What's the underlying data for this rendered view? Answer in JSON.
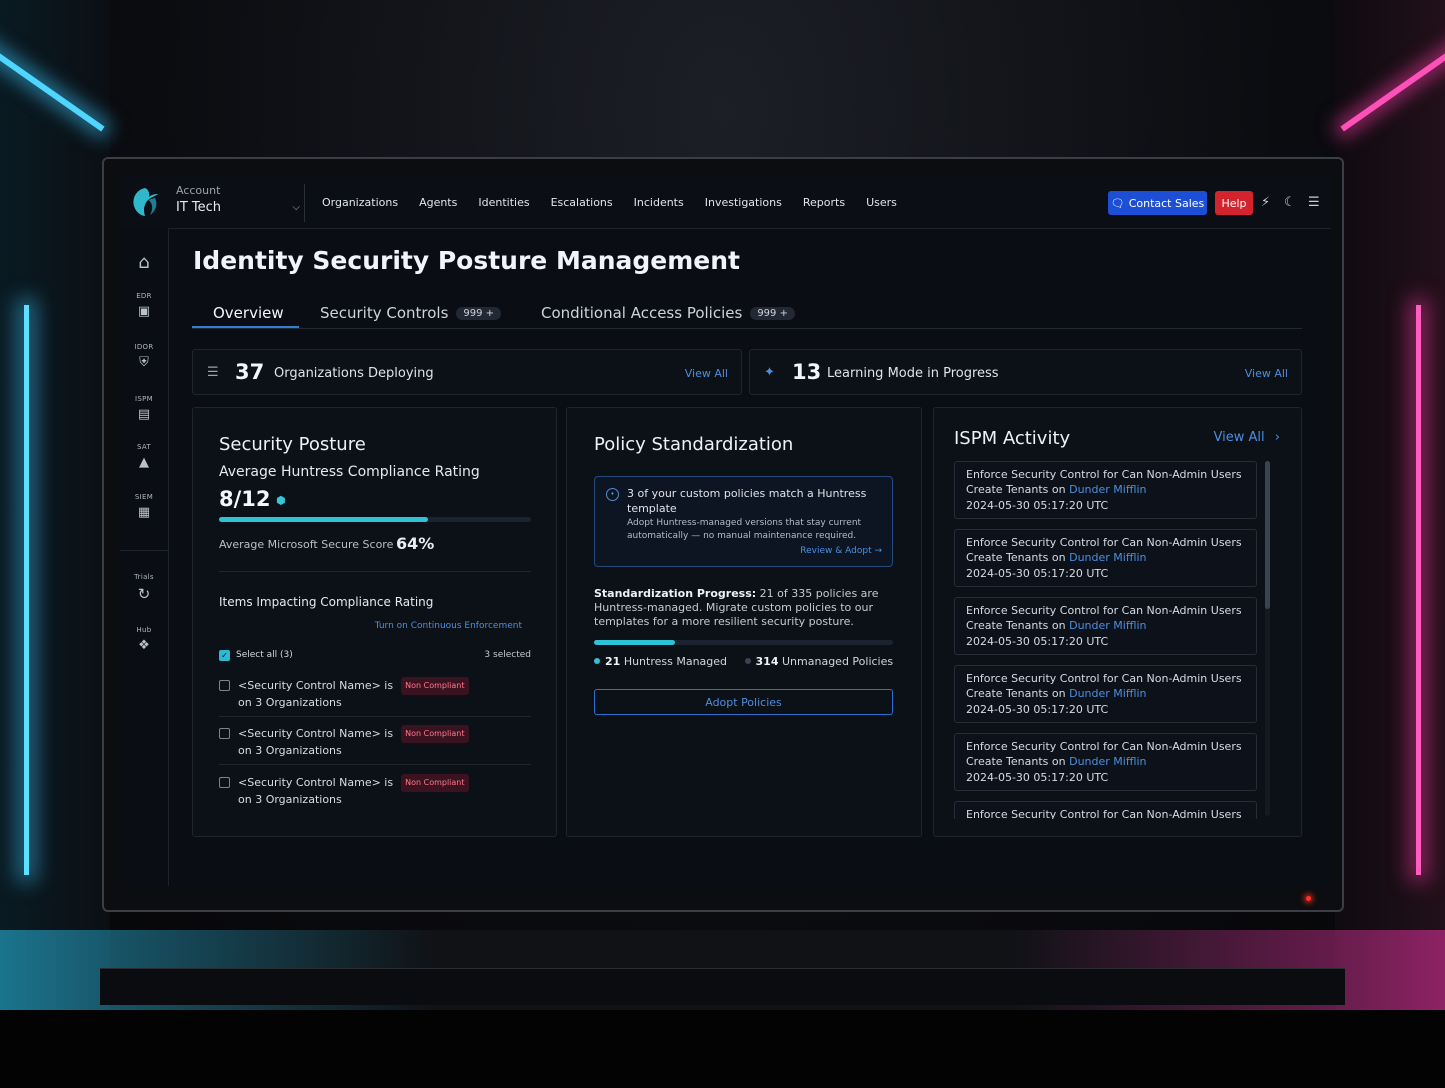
{
  "account": {
    "label": "Account",
    "name": "IT Tech"
  },
  "nav": [
    "Organizations",
    "Agents",
    "Identities",
    "Escalations",
    "Incidents",
    "Investigations",
    "Reports",
    "Users"
  ],
  "header": {
    "contact_sales": "Contact Sales",
    "help": "Help"
  },
  "sidebar": [
    {
      "label": "",
      "icon": "home-icon"
    },
    {
      "label": "EDR",
      "icon": "image-icon"
    },
    {
      "label": "IDOR",
      "icon": "shield-icon"
    },
    {
      "label": "ISPM",
      "icon": "id-card-icon"
    },
    {
      "label": "SAT",
      "icon": "graduation-icon"
    },
    {
      "label": "SIEM",
      "icon": "server-icon"
    },
    {
      "label": "Trials",
      "icon": "refresh-icon"
    },
    {
      "label": "Hub",
      "icon": "hub-icon"
    }
  ],
  "page_title": "Identity Security Posture Management",
  "tabs": [
    {
      "label": "Overview",
      "badge": ""
    },
    {
      "label": "Security Controls",
      "badge": "999 +"
    },
    {
      "label": "Conditional Access Policies",
      "badge": "999 +"
    }
  ],
  "stats": [
    {
      "value": "37",
      "label": "Organizations Deploying",
      "link": "View All"
    },
    {
      "value": "13",
      "label": "Learning Mode in Progress",
      "link": "View All"
    }
  ],
  "security_posture": {
    "title": "Security Posture",
    "subtitle": "Average Huntress Compliance Rating",
    "score": "8/12",
    "score_fraction": 0.67,
    "ms_label": "Average Microsoft Secure Score",
    "ms_value": "64%",
    "items_title": "Items Impacting Compliance Rating",
    "items_link": "Turn on Continuous Enforcement",
    "select_all": "Select all (3)",
    "selected_count": "3 selected",
    "items": [
      {
        "line1": "<Security Control Name> is",
        "badge": "Non Compliant",
        "line2": "on 3 Organizations"
      },
      {
        "line1": "<Security Control Name> is",
        "badge": "Non Compliant",
        "line2": "on 3 Organizations"
      },
      {
        "line1": "<Security Control Name> is",
        "badge": "Non Compliant",
        "line2": "on 3 Organizations"
      }
    ]
  },
  "policy": {
    "title": "Policy Standardization",
    "tip_head": "3 of your custom policies match a Huntress template",
    "tip_body": "Adopt Huntress-managed versions that stay current automatically — no manual maintenance required.",
    "tip_link": "Review & Adopt →",
    "progress_label": "Standardization Progress:",
    "progress_text": " 21 of 335 policies are Huntress-managed. Migrate custom policies to our templates for a more resilient security posture.",
    "progress_fraction": 0.27,
    "managed_value": "21",
    "managed_label": "Huntress Managed",
    "unmanaged_value": "314",
    "unmanaged_label": "Unmanaged Policies",
    "adopt_button": "Adopt Policies",
    "colors": {
      "managed": "#2dc2d6",
      "unmanaged": "#3a4352"
    }
  },
  "activity": {
    "title": "ISPM Activity",
    "link": "View All",
    "items": [
      {
        "line1": "Enforce Security Control for Can Non-Admin Users",
        "line2": "Create Tenants on",
        "org": "Dunder Mifflin",
        "time": "2024-05-30 05:17:20 UTC"
      },
      {
        "line1": "Enforce Security Control for Can Non-Admin Users",
        "line2": "Create Tenants on",
        "org": "Dunder Mifflin",
        "time": "2024-05-30 05:17:20 UTC"
      },
      {
        "line1": "Enforce Security Control for Can Non-Admin Users",
        "line2": "Create Tenants on",
        "org": "Dunder Mifflin",
        "time": "2024-05-30 05:17:20 UTC"
      },
      {
        "line1": "Enforce Security Control for Can Non-Admin Users",
        "line2": "Create Tenants on",
        "org": "Dunder Mifflin",
        "time": "2024-05-30 05:17:20 UTC"
      },
      {
        "line1": "Enforce Security Control for Can Non-Admin Users",
        "line2": "Create Tenants on",
        "org": "Dunder Mifflin",
        "time": "2024-05-30 05:17:20 UTC"
      },
      {
        "line1": "Enforce Security Control for Can Non-Admin Users",
        "line2": "",
        "org": "",
        "time": ""
      }
    ]
  }
}
